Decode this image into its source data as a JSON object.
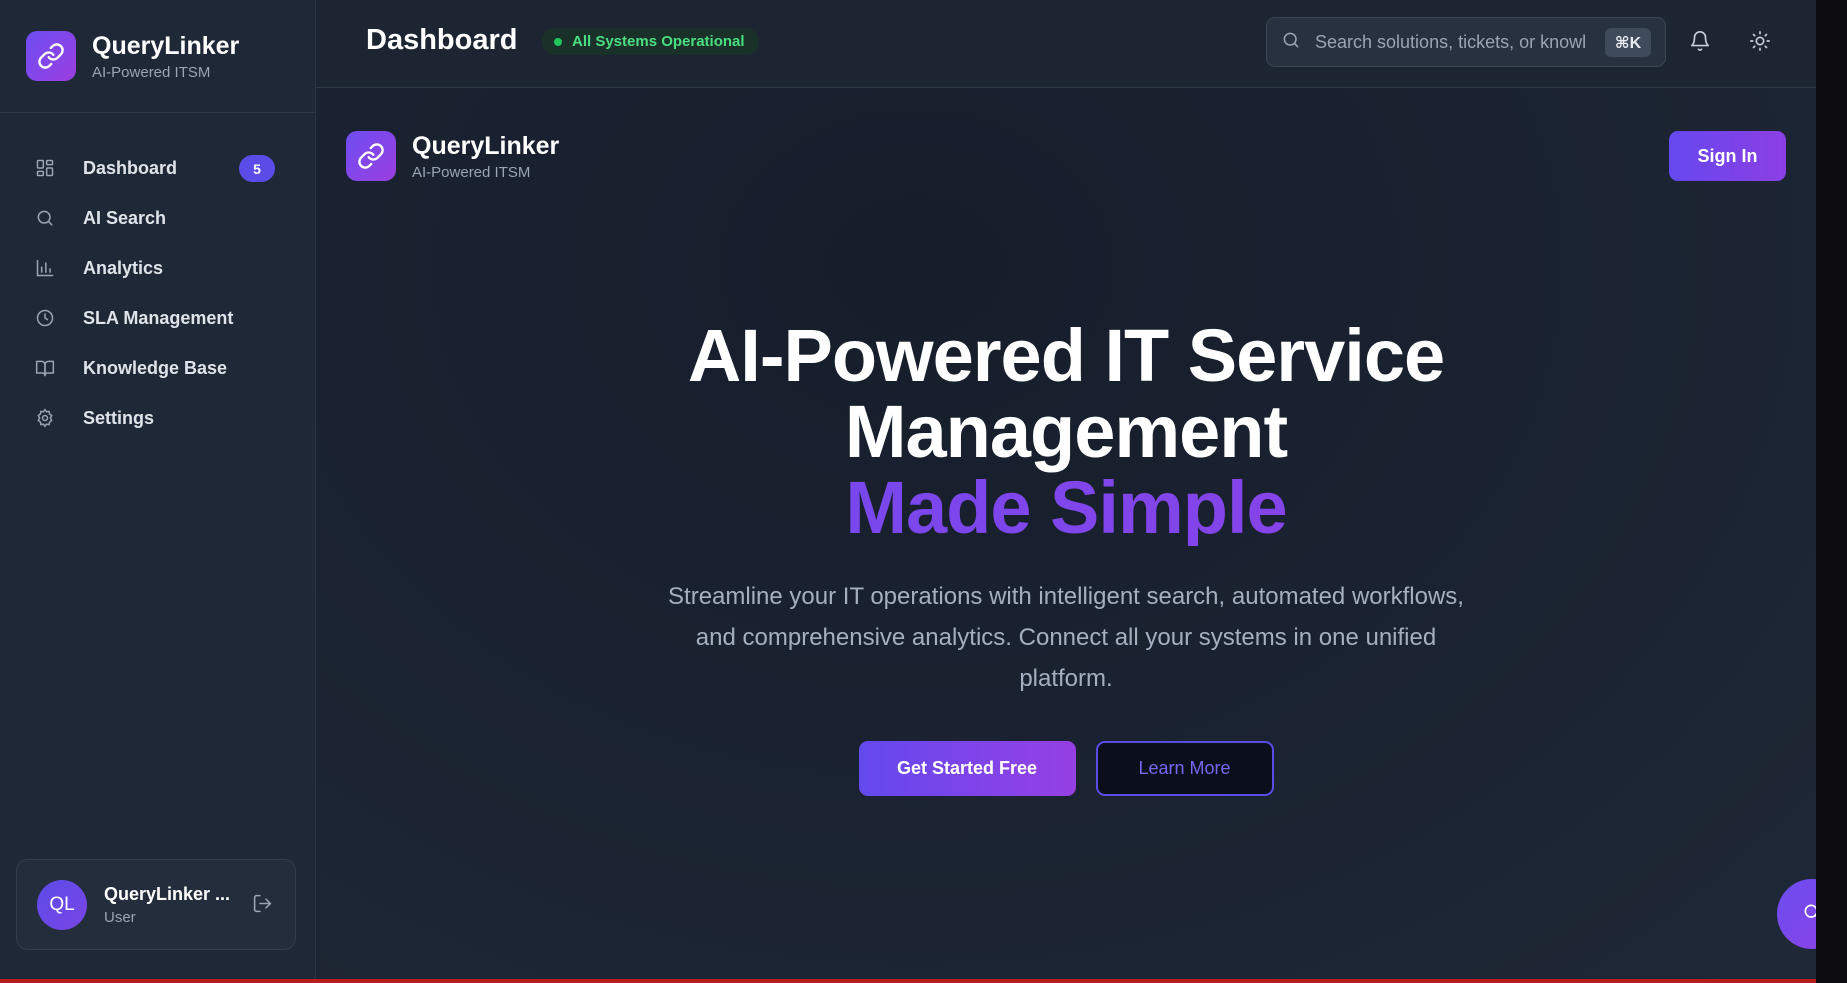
{
  "app": {
    "name": "QueryLinker",
    "subtitle": "AI-Powered ITSM"
  },
  "sidebar": {
    "items": [
      {
        "label": "Dashboard",
        "icon": "grid-icon",
        "badge": "5"
      },
      {
        "label": "AI Search",
        "icon": "search-icon"
      },
      {
        "label": "Analytics",
        "icon": "bar-chart-icon"
      },
      {
        "label": "SLA Management",
        "icon": "clock-icon"
      },
      {
        "label": "Knowledge Base",
        "icon": "book-icon"
      },
      {
        "label": "Settings",
        "icon": "gear-icon"
      }
    ],
    "user": {
      "initials": "QL",
      "name": "QueryLinker ...",
      "role": "User"
    }
  },
  "header": {
    "title": "Dashboard",
    "status": "All Systems Operational",
    "search_placeholder": "Search solutions, tickets, or knowledge...",
    "shortcut": "⌘K"
  },
  "main": {
    "brand_name": "QueryLinker",
    "brand_sub": "AI-Powered ITSM",
    "signin_label": "Sign In",
    "hero": {
      "line1": "AI-Powered IT Service",
      "line2": "Management",
      "accent": "Made Simple",
      "description": "Streamline your IT operations with intelligent search, automated workflows, and comprehensive analytics. Connect all your systems in one unified platform.",
      "primary_cta": "Get Started Free",
      "secondary_cta": "Learn More"
    }
  },
  "colors": {
    "accent": "#6a4bf0",
    "accent_end": "#9440e6",
    "status_green": "#4ade80",
    "background": "#1b2230"
  }
}
